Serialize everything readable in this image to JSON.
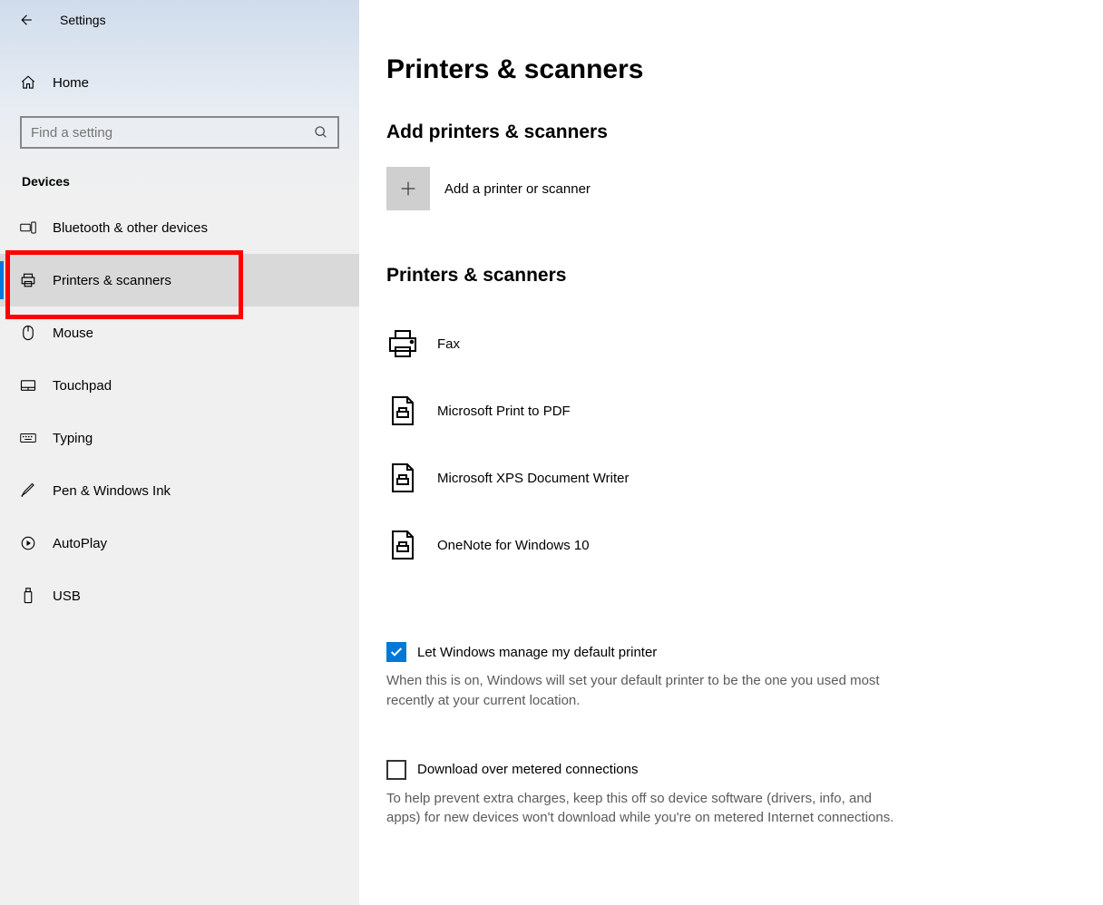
{
  "header": {
    "title": "Settings"
  },
  "home_label": "Home",
  "search": {
    "placeholder": "Find a setting"
  },
  "section_label": "Devices",
  "nav": [
    {
      "label": "Bluetooth & other devices"
    },
    {
      "label": "Printers & scanners"
    },
    {
      "label": "Mouse"
    },
    {
      "label": "Touchpad"
    },
    {
      "label": "Typing"
    },
    {
      "label": "Pen & Windows Ink"
    },
    {
      "label": "AutoPlay"
    },
    {
      "label": "USB"
    }
  ],
  "main": {
    "title": "Printers & scanners",
    "add_section": "Add printers & scanners",
    "add_label": "Add a printer or scanner",
    "list_section": "Printers & scanners",
    "printers": [
      {
        "label": "Fax"
      },
      {
        "label": "Microsoft Print to PDF"
      },
      {
        "label": "Microsoft XPS Document Writer"
      },
      {
        "label": "OneNote for Windows 10"
      }
    ],
    "default_check_label": "Let Windows manage my default printer",
    "default_help": "When this is on, Windows will set your default printer to be the one you used most recently at your current location.",
    "metered_check_label": "Download over metered connections",
    "metered_help": "To help prevent extra charges, keep this off so device software (drivers, info, and apps) for new devices won't download while you're on metered Internet connections."
  }
}
